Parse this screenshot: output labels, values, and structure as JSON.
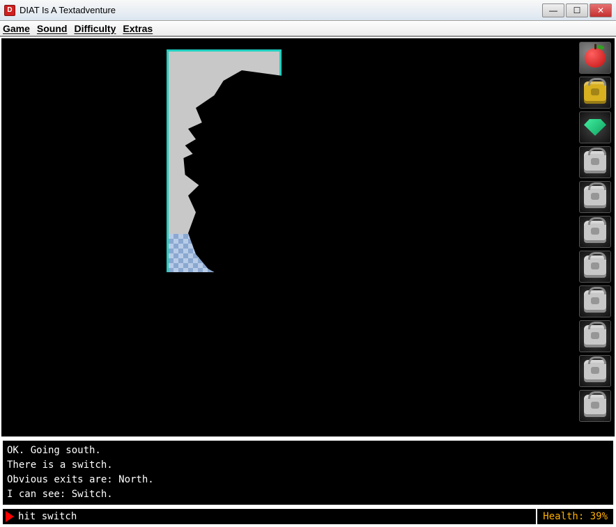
{
  "window": {
    "title": "DIAT Is A Textadventure"
  },
  "menu": {
    "game": "Game",
    "sound": "Sound",
    "difficulty": "Difficulty",
    "extras": "Extras"
  },
  "inventory": {
    "slots": [
      {
        "name": "apple"
      },
      {
        "name": "backpack-gold"
      },
      {
        "name": "gem-green"
      },
      {
        "name": "backpack-empty"
      },
      {
        "name": "backpack-empty"
      },
      {
        "name": "backpack-empty"
      },
      {
        "name": "backpack-empty"
      },
      {
        "name": "backpack-empty"
      },
      {
        "name": "backpack-empty"
      },
      {
        "name": "backpack-empty"
      },
      {
        "name": "backpack-empty"
      }
    ]
  },
  "log": {
    "line1": "OK. Going south.",
    "line2": "There is a switch.",
    "line3": "Obvious exits are: North.",
    "line4": "I can see: Switch."
  },
  "input": {
    "value": "hit switch"
  },
  "status": {
    "health_label": "Health: 39%"
  }
}
